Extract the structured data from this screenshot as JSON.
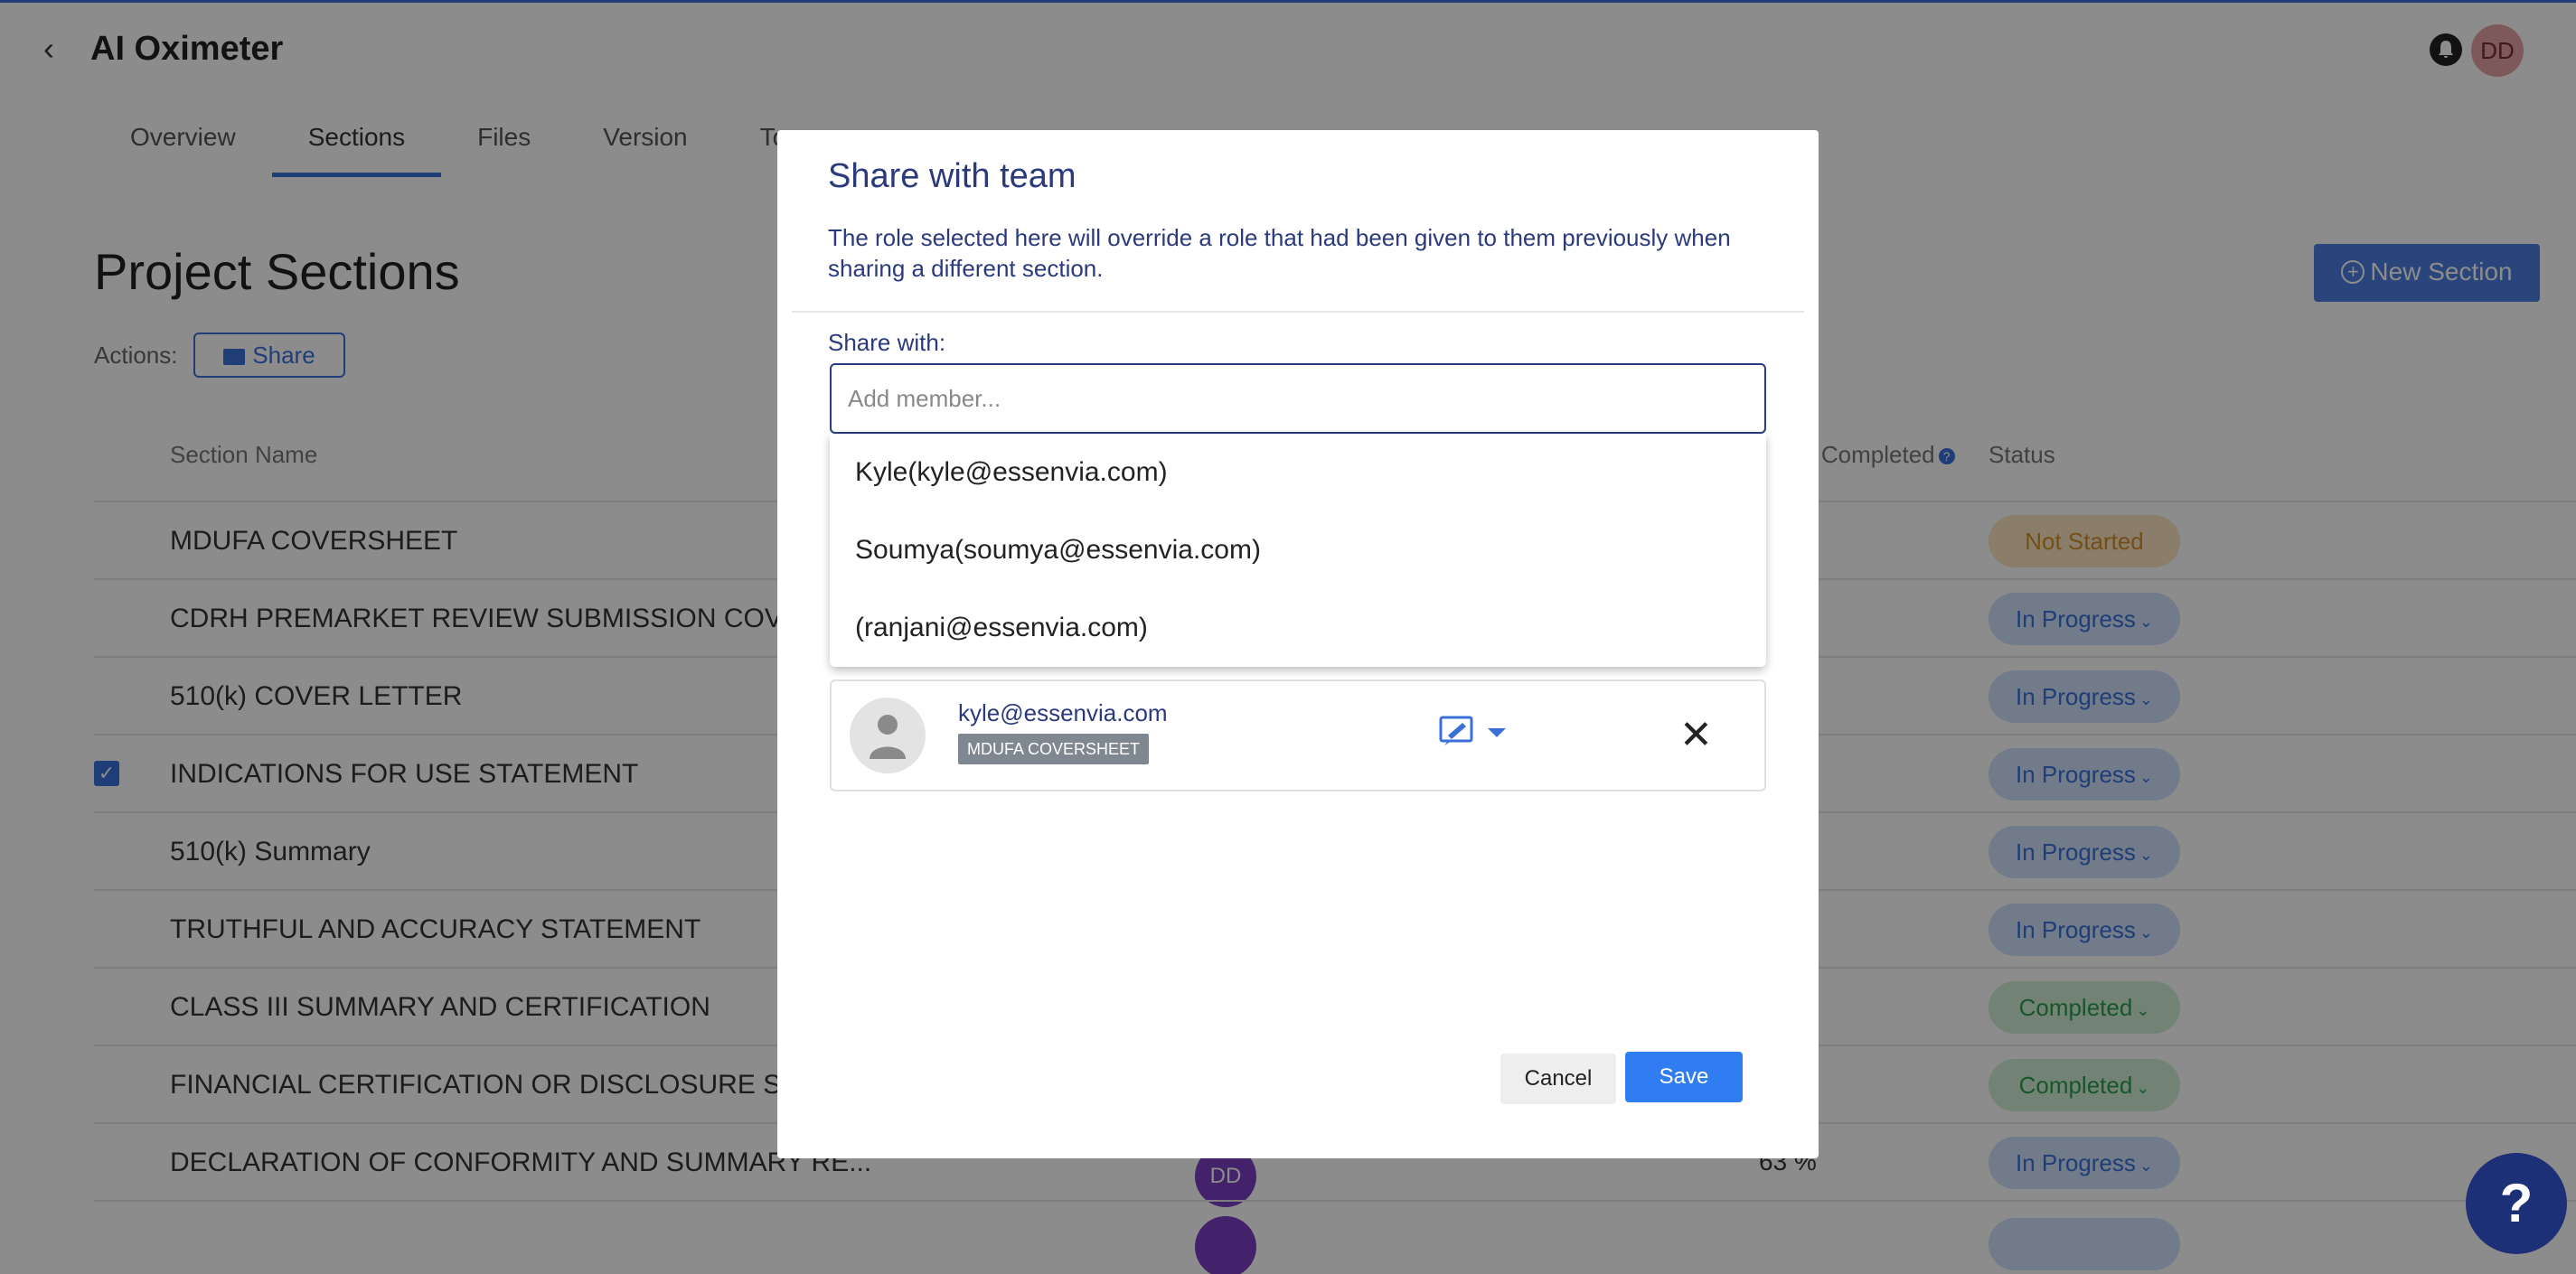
{
  "header": {
    "title": "AI Oximeter",
    "avatar_initials": "DD"
  },
  "tabs": [
    {
      "label": "Overview"
    },
    {
      "label": "Sections"
    },
    {
      "label": "Files"
    },
    {
      "label": "Version"
    },
    {
      "label": "To"
    }
  ],
  "page": {
    "heading": "Project Sections",
    "actions_label": "Actions:",
    "share_label": "Share",
    "new_section_label": "New Section"
  },
  "table": {
    "col_section_name": "Section Name",
    "col_percent_completed": "nt Completed",
    "col_status": "Status",
    "rows": [
      {
        "name": "MDUFA COVERSHEET",
        "status": "Not Started",
        "status_type": "not-started",
        "checked": false
      },
      {
        "name": "CDRH PREMARKET REVIEW SUBMISSION COVER",
        "status": "In Progress",
        "status_type": "in-progress",
        "checked": false
      },
      {
        "name": "510(k) COVER LETTER",
        "status": "In Progress",
        "status_type": "in-progress",
        "checked": false
      },
      {
        "name": "INDICATIONS FOR USE STATEMENT",
        "status": "In Progress",
        "status_type": "in-progress",
        "checked": true
      },
      {
        "name": "510(k) Summary",
        "status": "In Progress",
        "status_type": "in-progress",
        "checked": false
      },
      {
        "name": "TRUTHFUL AND ACCURACY STATEMENT",
        "status": "In Progress",
        "status_type": "in-progress",
        "checked": false
      },
      {
        "name": "CLASS III SUMMARY AND CERTIFICATION",
        "status": "Completed",
        "status_type": "completed",
        "checked": false
      },
      {
        "name": "FINANCIAL CERTIFICATION OR DISCLOSURE ST...",
        "status": "Completed",
        "status_type": "completed",
        "checked": false
      },
      {
        "name": "DECLARATION OF CONFORMITY AND SUMMARY RE...",
        "status": "In Progress",
        "status_type": "in-progress",
        "checked": false,
        "avatar": "DD",
        "percent": "63 %"
      }
    ]
  },
  "modal": {
    "title": "Share with team",
    "description": "The role selected here will override a role that had been given to them previously when sharing a different section.",
    "share_with_label": "Share with:",
    "input_placeholder": "Add member...",
    "input_value": "",
    "suggestions": [
      "Kyle(kyle@essenvia.com)",
      "Soumya(soumya@essenvia.com)",
      "(ranjani@essenvia.com)"
    ],
    "member": {
      "email": "kyle@essenvia.com",
      "section_tag": "MDUFA COVERSHEET",
      "role_icon": "edit-icon"
    },
    "cancel_label": "Cancel",
    "save_label": "Save"
  },
  "help_label": "?",
  "colors": {
    "accent": "#3a6fd8",
    "modal_text": "#2a3a7c",
    "save": "#2f7df0",
    "help_fab": "#1c2f77"
  }
}
